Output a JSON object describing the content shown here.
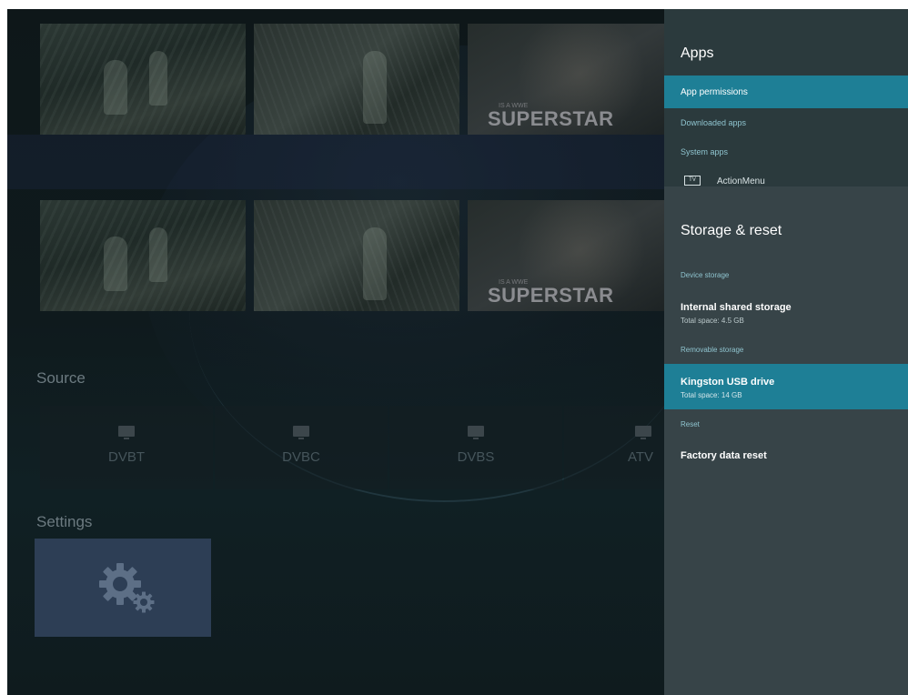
{
  "launcher": {
    "tiles": [
      {
        "superstar_top": "IS A WWE",
        "superstar_my": "MY",
        "superstar_text": "SUPERSTAR"
      }
    ],
    "source": {
      "title": "Source",
      "items": [
        {
          "label": "DVBT",
          "icon": "tv-icon"
        },
        {
          "label": "DVBC",
          "icon": "tv-icon"
        },
        {
          "label": "DVBS",
          "icon": "tv-icon"
        },
        {
          "label": "ATV",
          "icon": "antenna-icon"
        }
      ]
    },
    "settings": {
      "title": "Settings",
      "icon": "gear-icon"
    }
  },
  "panel": {
    "apps": {
      "title": "Apps",
      "items": [
        {
          "label": "App permissions",
          "selected": true
        },
        {
          "label": "Downloaded apps"
        },
        {
          "label": "System apps"
        }
      ],
      "app_entry": {
        "icon_text": "TV",
        "label": "ActionMenu"
      }
    },
    "storage": {
      "title": "Storage & reset",
      "device_storage_header": "Device storage",
      "internal": {
        "label": "Internal shared storage",
        "detail": "Total space: 4.5 GB"
      },
      "removable_storage_header": "Removable storage",
      "usb": {
        "label": "Kingston USB drive",
        "detail": "Total space: 14 GB",
        "selected": true
      },
      "reset_header": "Reset",
      "factory_reset": {
        "label": "Factory data reset"
      }
    }
  },
  "colors": {
    "accent": "#1e7f96",
    "panel_top": "#2b3a3d",
    "panel_bottom": "#374448",
    "header_text": "#8fc4cf"
  }
}
